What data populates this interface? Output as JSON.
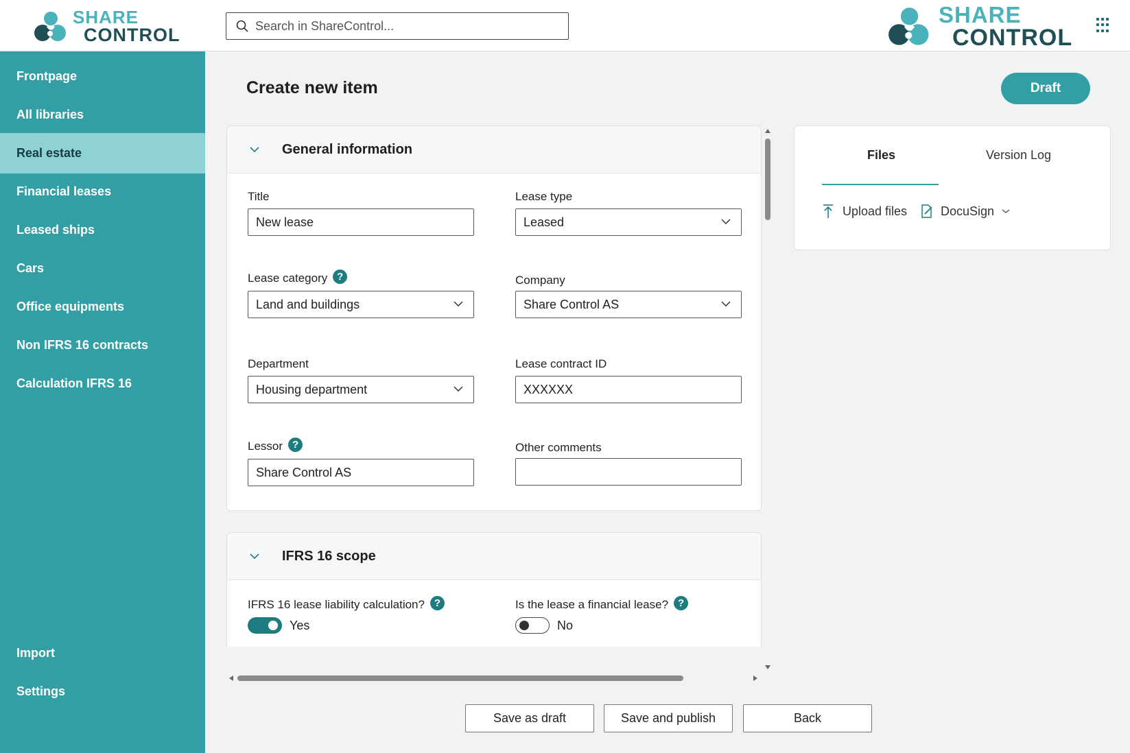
{
  "brand": {
    "line1": "SHARE",
    "line2": "CONTROL",
    "colors": {
      "teal": "#339ea3",
      "teal_light": "#8fd2d5",
      "teal_dark": "#1e7c80",
      "logo_dark": "#1f4f55",
      "logo_light": "#4ab2ba"
    }
  },
  "search": {
    "placeholder": "Search in ShareControl..."
  },
  "sidebar": {
    "items": [
      {
        "label": "Frontpage"
      },
      {
        "label": "All libraries"
      },
      {
        "label": "Real estate",
        "active": true
      },
      {
        "label": "Financial leases"
      },
      {
        "label": "Leased ships"
      },
      {
        "label": "Cars"
      },
      {
        "label": "Office equipments"
      },
      {
        "label": "Non IFRS 16 contracts"
      },
      {
        "label": "Calculation IFRS 16"
      }
    ],
    "bottom": [
      {
        "label": "Import"
      },
      {
        "label": "Settings"
      }
    ]
  },
  "page": {
    "title": "Create new item",
    "status_button": "Draft"
  },
  "general": {
    "title": "General information",
    "fields": {
      "title": {
        "label": "Title",
        "value": "New lease"
      },
      "lease_type": {
        "label": "Lease type",
        "value": "Leased"
      },
      "lease_category": {
        "label": "Lease category",
        "value": "Land and buildings"
      },
      "company": {
        "label": "Company",
        "value": "Share Control AS"
      },
      "department": {
        "label": "Department",
        "value": "Housing department"
      },
      "lease_contract_id": {
        "label": "Lease contract ID",
        "value": "XXXXXX"
      },
      "lessor": {
        "label": "Lessor",
        "value": "Share Control AS"
      },
      "other_comments": {
        "label": "Other comments",
        "value": ""
      }
    }
  },
  "ifrs": {
    "title": "IFRS 16 scope",
    "liability": {
      "label": "IFRS 16 lease liability calculation?",
      "on": true,
      "state_label": "Yes"
    },
    "financial": {
      "label": "Is the lease a financial lease?",
      "on": false,
      "state_label": "No"
    }
  },
  "help_glyph": "?",
  "files_panel": {
    "tabs": [
      {
        "label": "Files",
        "active": true
      },
      {
        "label": "Version Log"
      }
    ],
    "upload_label": "Upload files",
    "docusign_label": "DocuSign"
  },
  "actions": {
    "save_draft": "Save as draft",
    "save_publish": "Save and publish",
    "back": "Back"
  }
}
